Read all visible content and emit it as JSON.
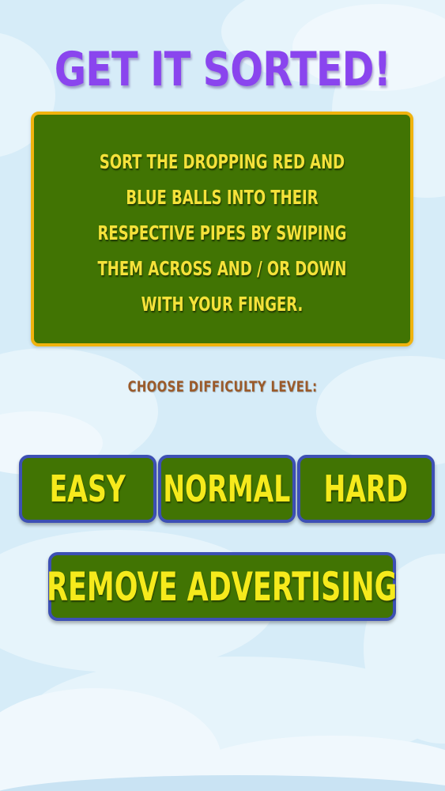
{
  "title": "GET IT SORTED!",
  "instructions": "SORT THE DROPPING RED AND BLUE BALLS INTO THEIR RESPECTIVE PIPES BY SWIPING THEM ACROSS AND / OR DOWN WITH YOUR FINGER.",
  "difficulty_label": "CHOOSE DIFFICULTY LEVEL:",
  "buttons": {
    "easy": "EASY",
    "normal": "NORMAL",
    "hard": "HARD",
    "remove_ads": "REMOVE ADVERTISING"
  },
  "colors": {
    "background": "#d6ecf8",
    "title": "#8a45ee",
    "panel_fill": "#417403",
    "panel_border": "#f0b30e",
    "panel_text": "#f5e23a",
    "label_text": "#9a5a2a",
    "button_fill": "#417403",
    "button_border": "#3d50b4",
    "button_text": "#f6ea1c"
  }
}
